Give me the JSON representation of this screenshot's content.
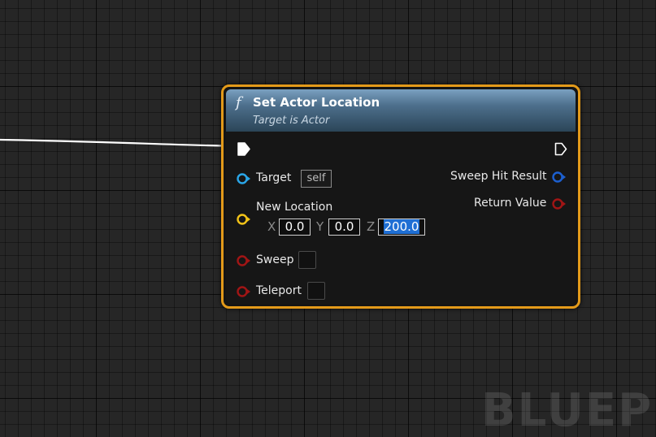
{
  "node": {
    "title": "Set Actor Location",
    "subtitle": "Target is Actor",
    "function_icon": "f",
    "border_color": "#e39a1a"
  },
  "inputs": {
    "target": {
      "label": "Target",
      "value": "self",
      "pin_color": "#2aa6e8"
    },
    "new_location": {
      "label": "New Location",
      "pin_color": "#f2c318",
      "x_label": "X",
      "x_value": "0.0",
      "y_label": "Y",
      "y_value": "0.0",
      "z_label": "Z",
      "z_value": "200.0"
    },
    "sweep": {
      "label": "Sweep",
      "checked": false,
      "pin_color": "#a11515"
    },
    "teleport": {
      "label": "Teleport",
      "checked": false,
      "pin_color": "#a11515"
    }
  },
  "outputs": {
    "sweep_hit_result": {
      "label": "Sweep Hit Result",
      "pin_color": "#1c5fcf"
    },
    "return_value": {
      "label": "Return Value",
      "pin_color": "#a11515"
    }
  },
  "watermark": "BLUEP"
}
